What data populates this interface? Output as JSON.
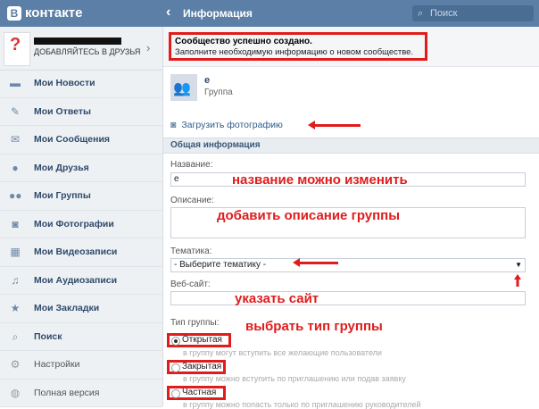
{
  "header": {
    "logo_letter": "В",
    "logo_text": "контакте",
    "title": "Информация",
    "search_placeholder": "Поиск"
  },
  "profile": {
    "add_friends": "ДОБАВЛЯЙТЕСЬ В ДРУЗЬЯ"
  },
  "sidebar": {
    "items": [
      {
        "label": "Мои Новости",
        "icon": "news-icon"
      },
      {
        "label": "Мои Ответы",
        "icon": "replies-icon"
      },
      {
        "label": "Мои Сообщения",
        "icon": "envelope-icon"
      },
      {
        "label": "Мои Друзья",
        "icon": "person-icon"
      },
      {
        "label": "Мои Группы",
        "icon": "group-icon"
      },
      {
        "label": "Мои Фотографии",
        "icon": "camera-icon"
      },
      {
        "label": "Мои Видеозаписи",
        "icon": "film-icon"
      },
      {
        "label": "Мои Аудиозаписи",
        "icon": "music-icon"
      },
      {
        "label": "Мои Закладки",
        "icon": "star-icon"
      },
      {
        "label": "Поиск",
        "icon": "search-icon"
      },
      {
        "label": "Настройки",
        "icon": "gear-icon"
      },
      {
        "label": "Полная версия",
        "icon": "globe-icon"
      }
    ]
  },
  "notice": {
    "title": "Сообщество успешно создано.",
    "text": "Заполните необходимую информацию о новом сообществе."
  },
  "group": {
    "name": "е",
    "type": "Группа"
  },
  "upload_label": "Загрузить фотографию",
  "section_title": "Общая информация",
  "form": {
    "name_label": "Название:",
    "name_value": "е",
    "description_label": "Описание:",
    "topic_label": "Тематика:",
    "topic_value": "- Выберите тематику -",
    "website_label": "Веб-сайт:",
    "group_type_label": "Тип группы:",
    "types": [
      {
        "label": "Открытая",
        "hint": "в группу могут вступить все желающие пользователи",
        "selected": true
      },
      {
        "label": "Закрытая",
        "hint": "в группу можно вступить по приглашению или подав заявку",
        "selected": false
      },
      {
        "label": "Частная",
        "hint": "в группу можно попасть только по приглашению руководителей",
        "selected": false
      }
    ]
  },
  "annotations": {
    "name": "название можно изменить",
    "description": "добавить описание группы",
    "website": "указать сайт",
    "type": "выбрать тип группы"
  },
  "colors": {
    "header": "#5b7fa6",
    "annotation": "#e01c1c",
    "sidebar_bg": "#eef1f4"
  }
}
